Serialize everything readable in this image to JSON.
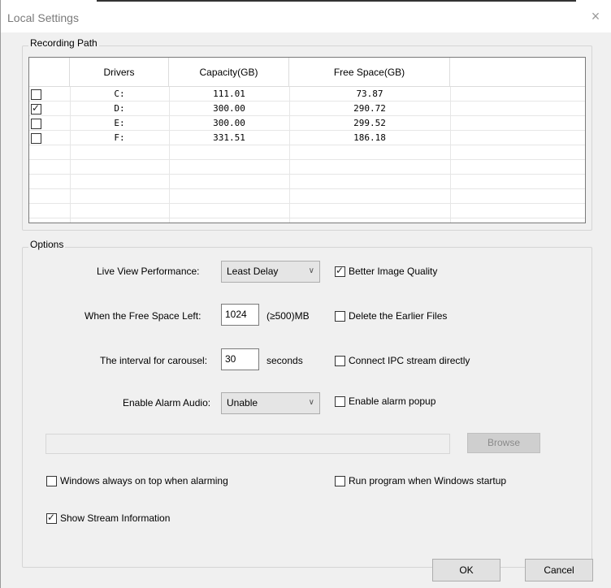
{
  "window": {
    "title": "Local Settings",
    "close_glyph": "×"
  },
  "recording_path": {
    "label": "Recording Path",
    "headers": [
      "Drivers",
      "Capacity(GB)",
      "Free Space(GB)"
    ],
    "rows": [
      {
        "driver": "C:",
        "capacity": "111.01",
        "free": "73.87",
        "checked": false
      },
      {
        "driver": "D:",
        "capacity": "300.00",
        "free": "290.72",
        "checked": true
      },
      {
        "driver": "E:",
        "capacity": "300.00",
        "free": "299.52",
        "checked": false
      },
      {
        "driver": "F:",
        "capacity": "331.51",
        "free": "186.18",
        "checked": false
      }
    ]
  },
  "options": {
    "label": "Options",
    "live_view": {
      "label": "Live View Performance:",
      "value": "Least Delay"
    },
    "free_space": {
      "label": "When the Free Space Left:",
      "value": "1024",
      "unit": "(≥500)MB"
    },
    "carousel": {
      "label": "The interval for carousel:",
      "value": "30",
      "unit": "seconds"
    },
    "alarm_audio": {
      "label": "Enable Alarm Audio:",
      "value": "Unable"
    },
    "better_quality": {
      "label": "Better Image Quality",
      "checked": true
    },
    "delete_earlier": {
      "label": "Delete the Earlier Files",
      "checked": false
    },
    "connect_ipc": {
      "label": "Connect IPC stream directly",
      "checked": false
    },
    "alarm_popup": {
      "label": "Enable alarm popup",
      "checked": false
    },
    "browse_label": "Browse",
    "windows_on_top": {
      "label": "Windows always on top when alarming",
      "checked": false
    },
    "run_startup": {
      "label": "Run program when Windows startup",
      "checked": false
    },
    "show_stream": {
      "label": "Show Stream Information",
      "checked": true
    }
  },
  "footer": {
    "ok_label": "OK",
    "cancel_label": "Cancel"
  }
}
